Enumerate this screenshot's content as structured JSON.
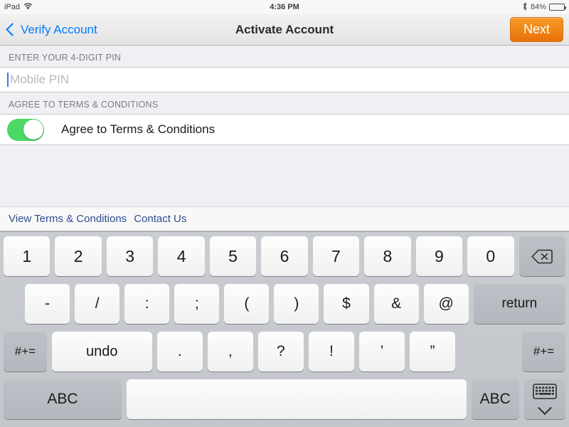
{
  "status_bar": {
    "carrier": "iPad",
    "wifi_icon": "wifi-icon",
    "time": "4:36 PM",
    "bluetooth_icon": "bluetooth-icon",
    "battery_percent": "84%",
    "battery_level": 84
  },
  "nav_bar": {
    "back_label": "Verify Account",
    "back_icon": "chevron-left-icon",
    "title": "Activate Account",
    "next_label": "Next",
    "next_color": "#F08A18"
  },
  "form": {
    "pin_section_header": "ENTER YOUR 4-DIGIT PIN",
    "pin_placeholder": "Mobile PIN",
    "pin_value": "",
    "terms_section_header": "AGREE TO TERMS & CONDITIONS",
    "terms_toggle_label": "Agree to Terms & Conditions",
    "terms_toggle_on": true,
    "toggle_on_color": "#4CD964"
  },
  "toolbar": {
    "links": [
      {
        "label": "View Terms & Conditions"
      },
      {
        "label": "Contact Us"
      }
    ],
    "link_color": "#2E4E8F"
  },
  "keyboard": {
    "row1": [
      {
        "label": "1",
        "style": "light"
      },
      {
        "label": "2",
        "style": "light"
      },
      {
        "label": "3",
        "style": "light"
      },
      {
        "label": "4",
        "style": "light"
      },
      {
        "label": "5",
        "style": "light"
      },
      {
        "label": "6",
        "style": "light"
      },
      {
        "label": "7",
        "style": "light"
      },
      {
        "label": "8",
        "style": "light"
      },
      {
        "label": "9",
        "style": "light"
      },
      {
        "label": "0",
        "style": "light"
      }
    ],
    "backspace_icon": "delete-backward-icon",
    "row2": [
      {
        "label": "-",
        "style": "light"
      },
      {
        "label": "/",
        "style": "light"
      },
      {
        "label": ":",
        "style": "light"
      },
      {
        "label": ";",
        "style": "light"
      },
      {
        "label": "(",
        "style": "light"
      },
      {
        "label": ")",
        "style": "light"
      },
      {
        "label": "$",
        "style": "light"
      },
      {
        "label": "&",
        "style": "light"
      },
      {
        "label": "@",
        "style": "light"
      }
    ],
    "return_label": "return",
    "row3_left_symbol": "#+=",
    "undo_label": "undo",
    "row3": [
      {
        "label": ".",
        "style": "light"
      },
      {
        "label": ",",
        "style": "light"
      },
      {
        "label": "?",
        "style": "light"
      },
      {
        "label": "!",
        "style": "light"
      },
      {
        "label": "’",
        "style": "light"
      },
      {
        "label": "”",
        "style": "light"
      }
    ],
    "row3_right_symbol": "#+=",
    "abc_left_label": "ABC",
    "space_label": "",
    "abc_right_label": "ABC",
    "hide_keyboard_icon": "hide-keyboard-icon"
  }
}
